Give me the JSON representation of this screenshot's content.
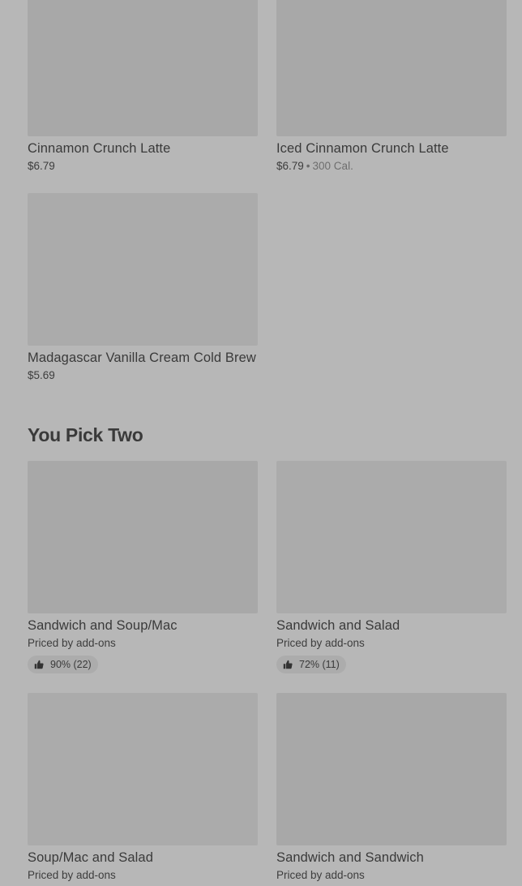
{
  "top_items": [
    {
      "name": "Cinnamon Crunch Latte",
      "price": "$6.79",
      "calories": ""
    },
    {
      "name": "Iced Cinnamon Crunch Latte",
      "price": "$6.79",
      "separator": "•",
      "calories": "300 Cal."
    },
    {
      "name": "Madagascar Vanilla Cream Cold Brew",
      "price": "$5.69",
      "calories": ""
    }
  ],
  "section": {
    "title": "You Pick Two"
  },
  "pick_two_items": [
    {
      "name": "Sandwich and Soup/Mac",
      "price": "Priced by add-ons",
      "rating": "90% (22)"
    },
    {
      "name": "Sandwich and Salad",
      "price": "Priced by add-ons",
      "rating": "72% (11)"
    },
    {
      "name": "Soup/Mac and Salad",
      "price": "Priced by add-ons",
      "rating": ""
    },
    {
      "name": "Sandwich and Sandwich",
      "price": "Priced by add-ons",
      "rating": ""
    }
  ],
  "icons": {
    "rating": "thumbs-up-icon"
  },
  "colors": {
    "background": "#b7b7b7",
    "image_placeholder": "#a8a8a8",
    "text": "#3a3a3a"
  }
}
